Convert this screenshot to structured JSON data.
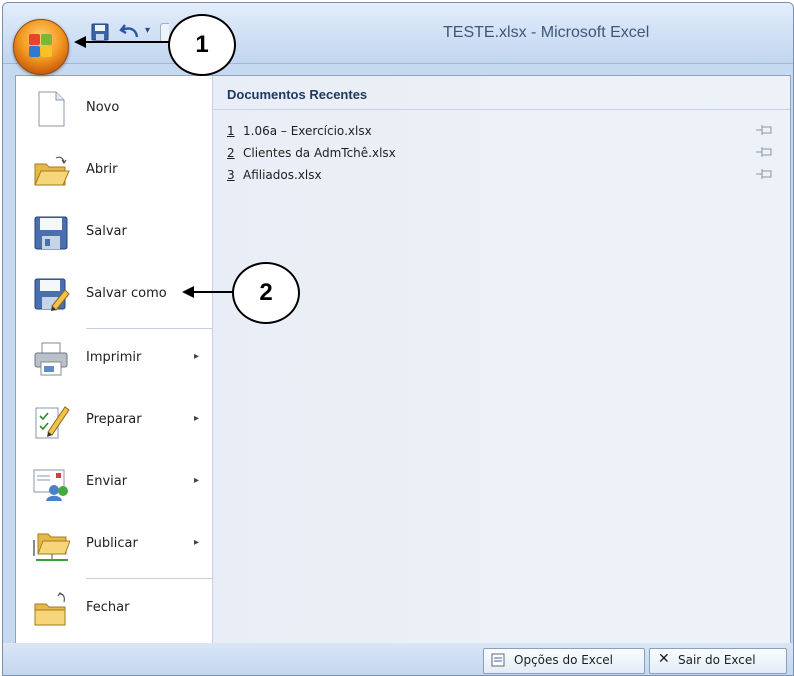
{
  "window": {
    "title": "TESTE.xlsx - Microsoft Excel"
  },
  "menu": {
    "items": [
      {
        "label": "Novo",
        "icon": "new-document-icon",
        "submenu": false
      },
      {
        "label": "Abrir",
        "icon": "open-folder-icon",
        "submenu": false
      },
      {
        "label": "Salvar",
        "icon": "save-disk-icon",
        "submenu": false
      },
      {
        "label": "Salvar como",
        "icon": "save-as-icon",
        "submenu": false
      },
      {
        "label": "Imprimir",
        "icon": "printer-icon",
        "submenu": true
      },
      {
        "label": "Preparar",
        "icon": "prepare-document-icon",
        "submenu": true
      },
      {
        "label": "Enviar",
        "icon": "send-icon",
        "submenu": true
      },
      {
        "label": "Publicar",
        "icon": "publish-folder-icon",
        "submenu": true
      },
      {
        "label": "Fechar",
        "icon": "close-folder-icon",
        "submenu": false
      }
    ],
    "submenu_glyph": "▸"
  },
  "recent": {
    "heading": "Documentos Recentes",
    "files": [
      {
        "num": "1",
        "name": "1.06a – Exercício.xlsx"
      },
      {
        "num": "2",
        "name": "Clientes da AdmTchê.xlsx"
      },
      {
        "num": "3",
        "name": "Afiliados.xlsx"
      }
    ]
  },
  "footer": {
    "options_label": "Opções do Excel",
    "exit_label": "Sair do Excel",
    "exit_glyph": "✕"
  },
  "callouts": {
    "one": "1",
    "two": "2"
  },
  "qat": {
    "dropdown_glyph": "▾"
  },
  "colors": {
    "office_button": "#f39a22",
    "title_text": "#3e5679",
    "accent": "#1f3a60"
  }
}
